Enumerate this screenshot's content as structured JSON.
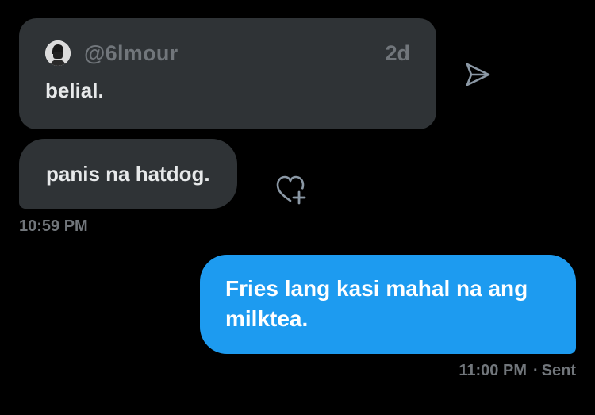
{
  "quoted_post": {
    "handle": "@6lmour",
    "age": "2d",
    "text": "belial."
  },
  "messages": [
    {
      "direction": "received",
      "text": "panis na hatdog.",
      "time": "10:59 PM"
    },
    {
      "direction": "sent",
      "text": "Fries lang kasi mahal na ang milktea.",
      "time": "11:00 PM",
      "separator": "·",
      "status": "Sent"
    }
  ],
  "icons": {
    "share": "paper-plane-icon",
    "react": "heart-plus-icon",
    "avatar": "user-avatar"
  },
  "colors": {
    "background": "#000000",
    "received_bubble": "#2f3336",
    "sent_bubble": "#1d9bf0",
    "muted_text": "#71767b"
  }
}
